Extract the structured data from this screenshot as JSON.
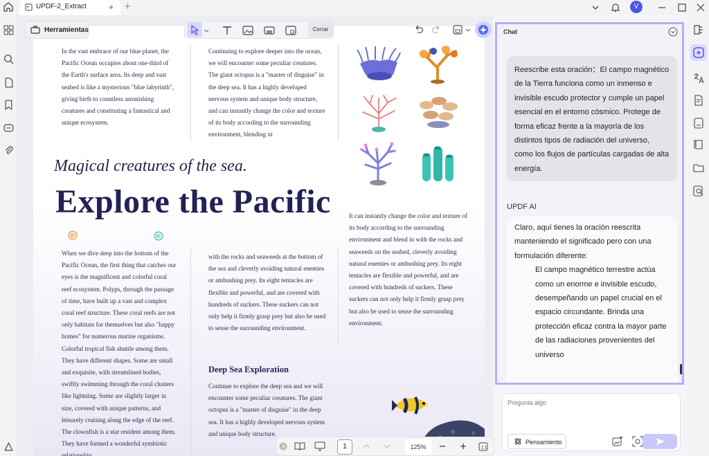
{
  "titlebar": {
    "tab_title": "UPDF-2_Extract",
    "avatar_letter": "V"
  },
  "toolbar": {
    "tools_label": "Herramientas",
    "close_label": "Cerrar"
  },
  "document": {
    "col1_top": "In the vast embrace of our blue planet, the Pacific Ocean occupies about one-third of the Earth's surface area. Its deep and vast seabed is like a mysterious \"blue labyrinth\", giving birth to countless astonishing creatures and constituting a fantastical and unique ecosystem.",
    "col2_top": "Continuing to explore deeper into the ocean, we will encounter some peculiar creatures. The giant octopus is a \"master of disguise\" in the deep sea. It has a highly developed nervous system and unique body structure, and can instantly change the color and texture of its body according to the surrounding environment, blending in",
    "subtitle": "Magical creatures of the sea.",
    "headline": "Explore the Pacific",
    "col1_bottom": "When we dive deep into the bottom of the Pacific Ocean, the first thing that catches our eyes is the magnificent and colorful coral reef ecosystem. Polyps, through the passage of time, have built up a vast and complex coral reef structure. These coral reefs are not only habitats for themselves but also \"happy homes\" for numerous marine organisms. Colorful tropical fish shuttle among them. They have different shapes. Some are small and exquisite, with streamlined bodies, swiftly swimming through the coral clusters like lightning. Some are slightly larger in size, covered with unique patterns, and leisurely cruising along the edge of the reef. The clownfish is a star resident among them. They have formed a wonderful symbiotic relationship",
    "col2_bottom": "with the rocks and seaweeds at the bottom of the sea and cleverly avoiding natural enemies or ambushing prey. Its eight tentacles are flexible and powerful, and are covered with hundreds of suckers. These suckers can not only help it firmly grasp prey but also be used to sense the surrounding environment.",
    "col3_bottom": "It can instantly change the color and texture of its body according to the surrounding environment and blend in with the rocks and seaweeds on the seabed, cleverly avoiding natural enemies or ambushing prey. Its eight tentacles are flexible and powerful, and are covered with hundreds of suckers. These suckers can not only help it firmly grasp prey but also be used to sense the surrounding environment.",
    "section_title": "Deep Sea Exploration",
    "col2_section": "Continue to explore the deep sea and we will encounter some peculiar creatures. The giant octopus is a \"master of disguise\" in the deep sea. It has a highly developed nervous system and unique body structure."
  },
  "bottombar": {
    "page_number": "1",
    "zoom": "125%"
  },
  "chat": {
    "title": "Chat",
    "user_message": "Reescribe esta oración：El campo magnético de la Tierra funciona como un inmenso e invisible escudo protector y cumple un papel esencial en el entorno cósmico. Protege de forma eficaz frente a la mayoría de los distintos tipos de radiación del universo, como los flujos de partículas cargadas de alta energía.",
    "ai_label": "UPDF AI",
    "ai_intro": "Claro, aquí tienes la oración reescrita manteniendo el significado pero con una formulación diferente:",
    "ai_quote": "El campo magnético terrestre actúa como un enorme e invisible escudo, desempeñando un papel crucial en el espacio circundante. Brinda una protección eficaz contra la mayor parte de las radiaciones provenientes del universo",
    "input_placeholder": "Pregunta algo",
    "thinking_label": "Pensamiento"
  },
  "colors": {
    "accent": "#b6aef6",
    "brand": "#4d55e6",
    "send": "#c9c8fb"
  }
}
